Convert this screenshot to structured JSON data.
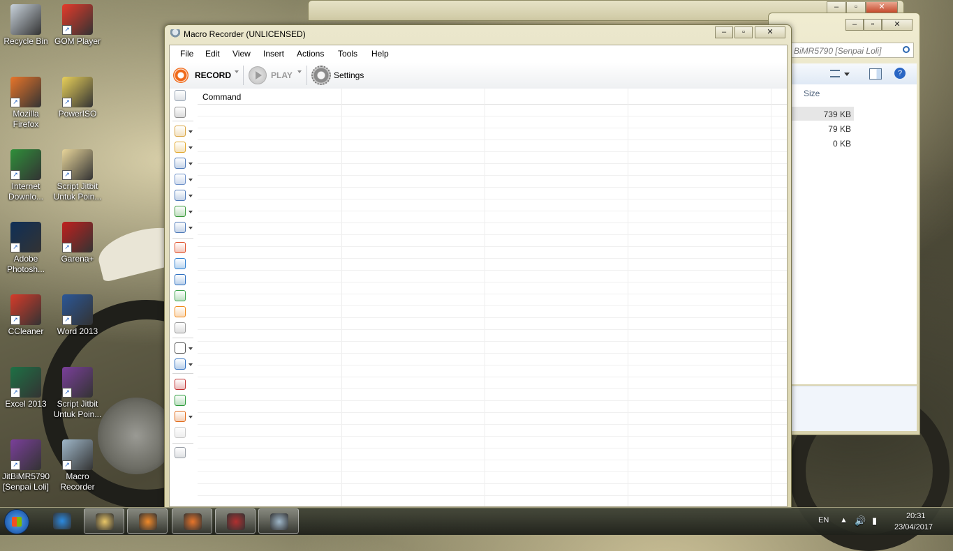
{
  "desktop": {
    "icons": [
      {
        "label": "Recycle Bin",
        "icon": "recycle-bin-icon",
        "color": "#c9d3dc"
      },
      {
        "label": "GOM Player",
        "icon": "gom-player-icon",
        "color": "#e53a2a"
      },
      {
        "label": "Mozilla Firefox",
        "icon": "firefox-icon",
        "color": "#e8752a"
      },
      {
        "label": "PowerISO",
        "icon": "poweriso-icon",
        "color": "#e8d05a"
      },
      {
        "label": "Internet Downlo...",
        "icon": "internet-download-manager-icon",
        "color": "#2f8f3a"
      },
      {
        "label": "Script Jitbit Untuk Poin...",
        "icon": "folder-icon",
        "color": "#e8d59a"
      },
      {
        "label": "Adobe Photosh...",
        "icon": "photoshop-icon",
        "color": "#0f2f57"
      },
      {
        "label": "Garena+",
        "icon": "garena-icon",
        "color": "#c0201e"
      },
      {
        "label": "CCleaner",
        "icon": "ccleaner-icon",
        "color": "#d63b2a"
      },
      {
        "label": "Word 2013",
        "icon": "word-icon",
        "color": "#2b5797"
      },
      {
        "label": "Excel 2013",
        "icon": "excel-icon",
        "color": "#1e7145"
      },
      {
        "label": "Script Jitbit Untuk Poin...",
        "icon": "winrar-icon",
        "color": "#7a3f9a"
      },
      {
        "label": "JitBiMR5790 [Senpai Loli]",
        "icon": "winrar-icon",
        "color": "#7a3f9a"
      },
      {
        "label": "Macro Recorder",
        "icon": "macro-recorder-icon",
        "color": "#9fb7c9"
      }
    ]
  },
  "explorer": {
    "address": "BiMR5790 [Senpai Loli]",
    "column_header": "Size",
    "sizes": [
      "739 KB",
      "79 KB",
      "0 KB"
    ]
  },
  "macro_recorder": {
    "title": "Macro Recorder (UNLICENSED)",
    "menu": [
      "File",
      "Edit",
      "View",
      "Insert",
      "Actions",
      "Tools",
      "Help"
    ],
    "toolbar": {
      "record": "RECORD",
      "play": "PLAY",
      "settings": "Settings"
    },
    "grid": {
      "column": "Command"
    },
    "sidebar_tools": [
      "mouse-icon",
      "keyboard-icon",
      "hourglass-icon",
      "window-icon",
      "window-resize-icon",
      "clipboard-icon",
      "text-icon",
      "color-picker-icon",
      "image-search-icon",
      "stop-icon",
      "web-icon",
      "info-icon",
      "internet-icon",
      "play-macro-icon",
      "csharp-icon",
      "if-icon",
      "loop-icon",
      "label-icon",
      "goto-icon",
      "pause-icon",
      "comment-icon",
      "debug-icon"
    ]
  },
  "taskbar": {
    "apps": [
      {
        "icon": "internet-explorer-icon",
        "color": "#2b8ae0"
      },
      {
        "icon": "file-explorer-icon",
        "color": "#e9c667"
      },
      {
        "icon": "media-player-icon",
        "color": "#f08a2a"
      },
      {
        "icon": "firefox-icon",
        "color": "#e8752a"
      },
      {
        "icon": "skull-app-icon",
        "color": "#b03030"
      },
      {
        "icon": "macro-recorder-icon",
        "color": "#9fb7c9"
      }
    ],
    "language": "EN",
    "time": "20:31",
    "date": "23/04/2017"
  }
}
